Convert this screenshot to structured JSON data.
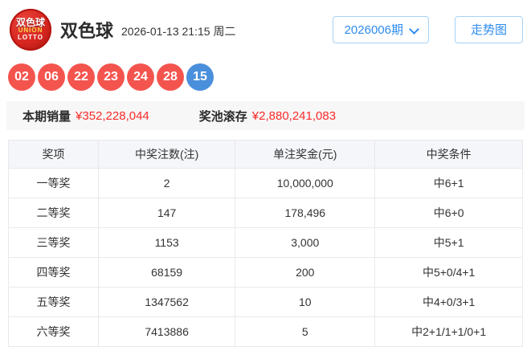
{
  "header": {
    "logo": {
      "line1": "双色球",
      "line2": "UNION",
      "line3": "LOTTO"
    },
    "title": "双色球",
    "datetime": "2026-01-13 21:15 周二",
    "issue_select_label": "2026006期",
    "trend_button_label": "走势图"
  },
  "draw": {
    "red_balls": [
      "02",
      "06",
      "22",
      "23",
      "24",
      "28"
    ],
    "blue_balls": [
      "15"
    ]
  },
  "summary": {
    "sales_label": "本期销量",
    "sales_value": "¥352,228,044",
    "pool_label": "奖池滚存",
    "pool_value": "¥2,880,241,083"
  },
  "prize_table": {
    "headers": [
      "奖项",
      "中奖注数(注)",
      "单注奖金(元)",
      "中奖条件"
    ],
    "rows": [
      [
        "一等奖",
        "2",
        "10,000,000",
        "中6+1"
      ],
      [
        "二等奖",
        "147",
        "178,496",
        "中6+0"
      ],
      [
        "三等奖",
        "1153",
        "3,000",
        "中5+1"
      ],
      [
        "四等奖",
        "68159",
        "200",
        "中5+0/4+1"
      ],
      [
        "五等奖",
        "1347562",
        "10",
        "中4+0/3+1"
      ],
      [
        "六等奖",
        "7413886",
        "5",
        "中2+1/1+1/0+1"
      ]
    ]
  },
  "colors": {
    "red_ball": "#f4544e",
    "blue_ball": "#4a8fdc",
    "accent_blue": "#2d8cf0",
    "money_red": "#fb2a2a"
  }
}
